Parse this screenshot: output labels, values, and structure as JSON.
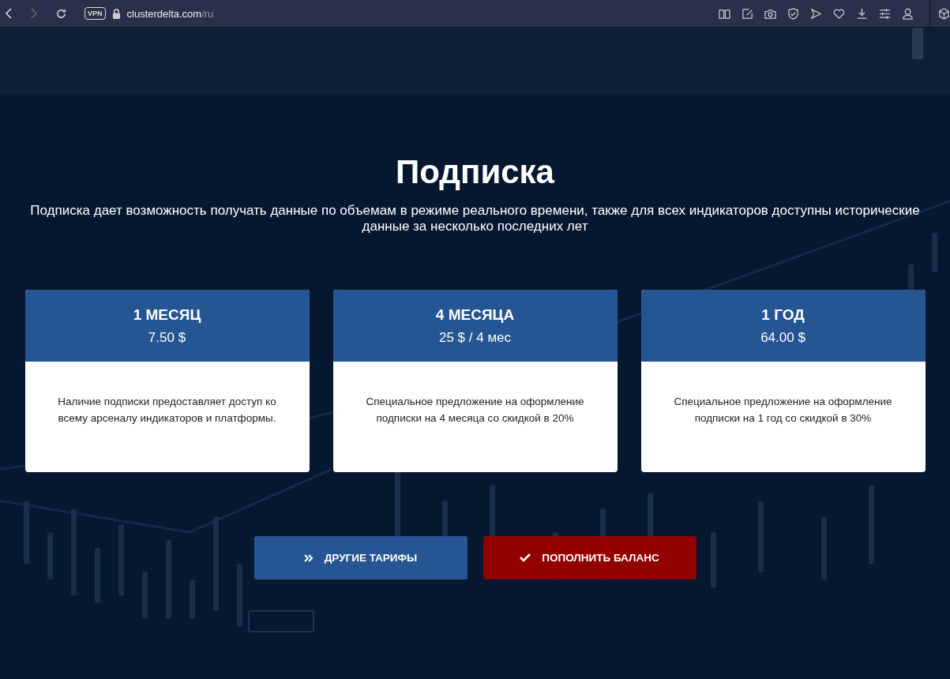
{
  "browser": {
    "vpn_badge": "VPN",
    "url_host": "clusterdelta.com",
    "url_path": "/ru"
  },
  "heading": "Подписка",
  "subtitle": "Подписка дает возможность получать данные по объемам в режиме реального времени, также для всех индикаторов доступны исторические данные за несколько последних лет",
  "plans": [
    {
      "name": "1 МЕСЯЦ",
      "price": "7.50 $",
      "description": "Наличие подписки предоставляет доступ ко всему арсеналу индикаторов и платформы."
    },
    {
      "name": "4 МЕСЯЦА",
      "price": "25 $ / 4 мес",
      "description": "Специальное предложение на оформление подписки на 4 месяца со скидкой в 20%"
    },
    {
      "name": "1 ГОД",
      "price": "64.00 $",
      "description": "Специальное предложение на оформление подписки на 1 год со скидкой в 30%"
    }
  ],
  "buttons": [
    {
      "label": "ДРУГИЕ ТАРИФЫ",
      "kind": "secondary"
    },
    {
      "label": "ПОПОЛНИТЬ БАЛАНС",
      "kind": "primary"
    }
  ]
}
